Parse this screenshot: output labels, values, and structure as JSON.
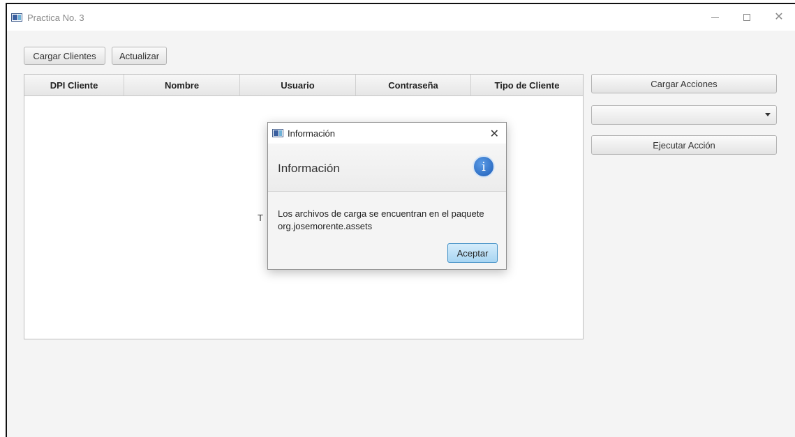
{
  "window": {
    "title": "Practica No. 3"
  },
  "toolbar": {
    "load_clients": "Cargar Clientes",
    "refresh": "Actualizar"
  },
  "table": {
    "columns": [
      "DPI Cliente",
      "Nombre",
      "Usuario",
      "Contraseña",
      "Tipo de Cliente"
    ],
    "placeholder_visible": "T"
  },
  "right_panel": {
    "load_actions": "Cargar Acciones",
    "combo_value": "",
    "execute_action": "Ejecutar Acción"
  },
  "dialog": {
    "title": "Información",
    "header": "Información",
    "message": "Los archivos de carga se encuentran en el paquete org.josemorente.assets",
    "ok": "Aceptar",
    "icon": "info-icon"
  }
}
